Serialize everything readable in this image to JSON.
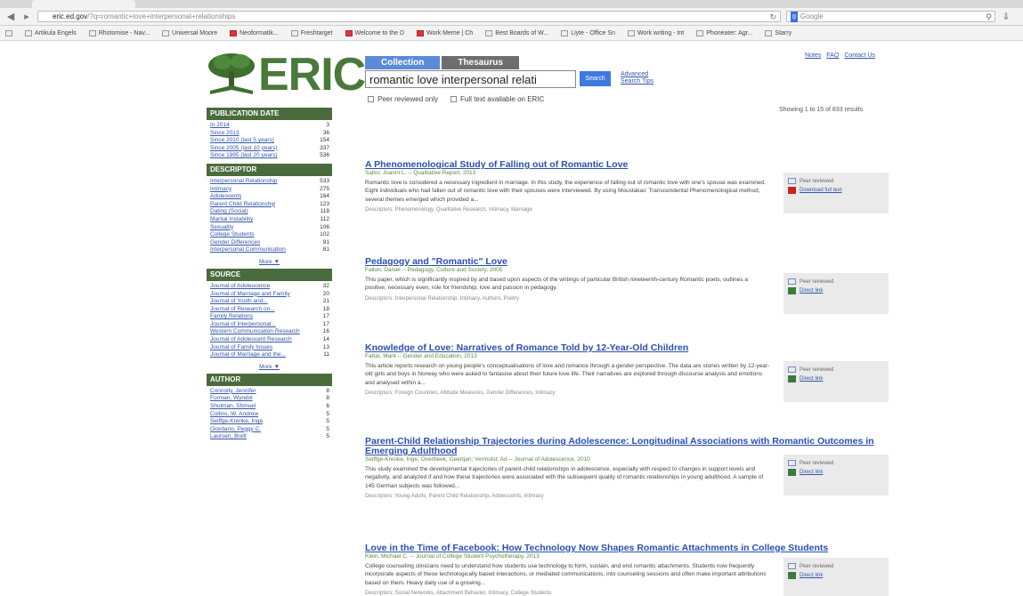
{
  "browser": {
    "url_host": "eric.ed.gov",
    "url_path": "/?q=romantic+love+interpersonal+relationships",
    "search_engine": "Google",
    "bookmarks": [
      "Artikula Engels",
      "Rhotomise - Nav...",
      "Universal Moore",
      "Neoformatik...",
      "Freshtarget",
      "Welcome to the D",
      "Work Meme | Ch",
      "Best Boards of W...",
      "Liyte - Office Sn",
      "Work writing - tnt",
      "Phoneater: Agr...",
      "Starry"
    ]
  },
  "logo": {
    "text": "ERIC"
  },
  "tabs": {
    "collection": "Collection",
    "thesaurus": "Thesaurus"
  },
  "search": {
    "query": "romantic love interpersonal relati",
    "button": "Search",
    "advanced": "Advanced",
    "tips": "Search Tips"
  },
  "toplinks": [
    "Notes",
    "FAQ",
    "Contact Us"
  ],
  "filters": {
    "peer": "Peer reviewed only",
    "fulltext": "Full text available on ERIC"
  },
  "showing": "Showing 1 to 15 of 833 results",
  "sidebar": {
    "publication_date": {
      "title": "PUBLICATION DATE",
      "items": [
        {
          "label": "In 2014",
          "count": "3"
        },
        {
          "label": "Since 2013",
          "count": "36"
        },
        {
          "label": "Since 2010 (last 5 years)",
          "count": "154"
        },
        {
          "label": "Since 2005 (last 10 years)",
          "count": "337"
        },
        {
          "label": "Since 1995 (last 20 years)",
          "count": "536"
        }
      ]
    },
    "descriptor": {
      "title": "DESCRIPTOR",
      "items": [
        {
          "label": "Interpersonal Relationship",
          "count": "533"
        },
        {
          "label": "Intimacy",
          "count": "275"
        },
        {
          "label": "Adolescents",
          "count": "164"
        },
        {
          "label": "Parent Child Relationship",
          "count": "123"
        },
        {
          "label": "Dating (Social)",
          "count": "118"
        },
        {
          "label": "Marital Instability",
          "count": "112"
        },
        {
          "label": "Sexuality",
          "count": "106"
        },
        {
          "label": "College Students",
          "count": "102"
        },
        {
          "label": "Gender Differences",
          "count": "91"
        },
        {
          "label": "Interpersonal Communication",
          "count": "81"
        }
      ],
      "more": "More ▼"
    },
    "source": {
      "title": "SOURCE",
      "items": [
        {
          "label": "Journal of Adolescence",
          "count": "32"
        },
        {
          "label": "Journal of Marriage and Family",
          "count": "20"
        },
        {
          "label": "Journal of Youth and...",
          "count": "21"
        },
        {
          "label": "Journal of Research on...",
          "count": "18"
        },
        {
          "label": "Family Relations",
          "count": "17"
        },
        {
          "label": "Journal of Interpersonal...",
          "count": "17"
        },
        {
          "label": "Western Communication Research",
          "count": "16"
        },
        {
          "label": "Journal of Adolescent Research",
          "count": "14"
        },
        {
          "label": "Journal of Family Issues",
          "count": "13"
        },
        {
          "label": "Journal of Marriage and the...",
          "count": "11"
        }
      ],
      "more": "More ▼"
    },
    "author": {
      "title": "AUTHOR",
      "items": [
        {
          "label": "Connolly, Jennifer",
          "count": "8"
        },
        {
          "label": "Furman, Wyndol",
          "count": "8"
        },
        {
          "label": "Shulman, Shmuel",
          "count": "6"
        },
        {
          "label": "Collins, W. Andrew",
          "count": "5"
        },
        {
          "label": "Seiffge-Krenke, Inge",
          "count": "5"
        },
        {
          "label": "Giordano, Peggy C.",
          "count": "5"
        },
        {
          "label": "Laursen, Brett",
          "count": "5"
        }
      ]
    }
  },
  "results": [
    {
      "title": "A Phenomenological Study of Falling out of Romantic Love",
      "meta": "Sailor, Joanni L. -- Qualitative Report, 2013",
      "abstract": "Romantic love is considered a necessary ingredient in marriage. In this study, the experience of falling out of romantic love with one's spouse was examined. Eight individuals who had fallen out of romantic love with their spouses were interviewed. By using Moustakas' Transcendental Phenomenological method, several themes emerged which provided a...",
      "descriptors": "Descriptors: Phenomenology, Qualitative Research, Intimacy, Marriage",
      "peer": "Peer reviewed",
      "link": "Download full text",
      "pdf": true
    },
    {
      "title": "Pedagogy and \"Romantic\" Love",
      "meta": "Fallon, Daniel -- Pedagogy, Culture and Society, 2005",
      "abstract": "This paper, which is significantly inspired by and based upon aspects of the writings of particular British nineteenth-century Romantic poets, outlines a positive, necessary even, role for friendship, love and passion in pedagogy.",
      "descriptors": "Descriptors: Interpersonal Relationship, Intimacy, Authors, Poetry",
      "peer": "Peer reviewed",
      "link": "Direct link",
      "pdf": false
    },
    {
      "title": "Knowledge of Love: Narratives of Romance Told by 12-Year-Old Children",
      "meta": "Fattar, Marit -- Gender and Education, 2013",
      "abstract": "This article reports research on young people's conceptualisations of love and romance through a gender perspective. The data are stories written by 12-year-old girls and boys in Norway who were asked to fantasise about their future love life. Their narratives are explored through discourse analysis and emotions and analysed within a...",
      "descriptors": "Descriptors: Foreign Countries, Attitude Measures, Gender Differences, Intimacy",
      "peer": "Peer reviewed",
      "link": "Direct link",
      "pdf": false
    },
    {
      "title": "Parent-Child Relationship Trajectories during Adolescence: Longitudinal Associations with Romantic Outcomes in Emerging Adulthood",
      "meta": "Seiffge-Krenke, Inge; Overbeek, Geertjan; Vermulst, Ad -- Journal of Adolescence, 2010",
      "abstract": "This study examined the developmental trajectories of parent-child relationships in adolescence, especially with respect to changes in support levels and negativity, and analyzed if and how these trajectories were associated with the subsequent quality of romantic relationships in young adulthood. A sample of 145 German subjects was followed...",
      "descriptors": "Descriptors: Young Adults, Parent Child Relationship, Adolescents, Intimacy",
      "peer": "Peer reviewed",
      "link": "Direct link",
      "pdf": false
    },
    {
      "title": "Love in the Time of Facebook: How Technology Now Shapes Romantic Attachments in College Students",
      "meta": "Klein, Michael C. -- Journal of College Student Psychotherapy, 2013",
      "abstract": "College counseling clinicians need to understand how students use technology to form, sustain, and end romantic attachments. Students now frequently incorporate aspects of these technologically based interactions, or mediated communications, into counseling sessions and often make important attributions based on them. Heavy daily use of a growing...",
      "descriptors": "Descriptors: Social Networks, Attachment Behavior, Intimacy, College Students",
      "peer": "Peer reviewed",
      "link": "Direct link",
      "pdf": false
    }
  ]
}
